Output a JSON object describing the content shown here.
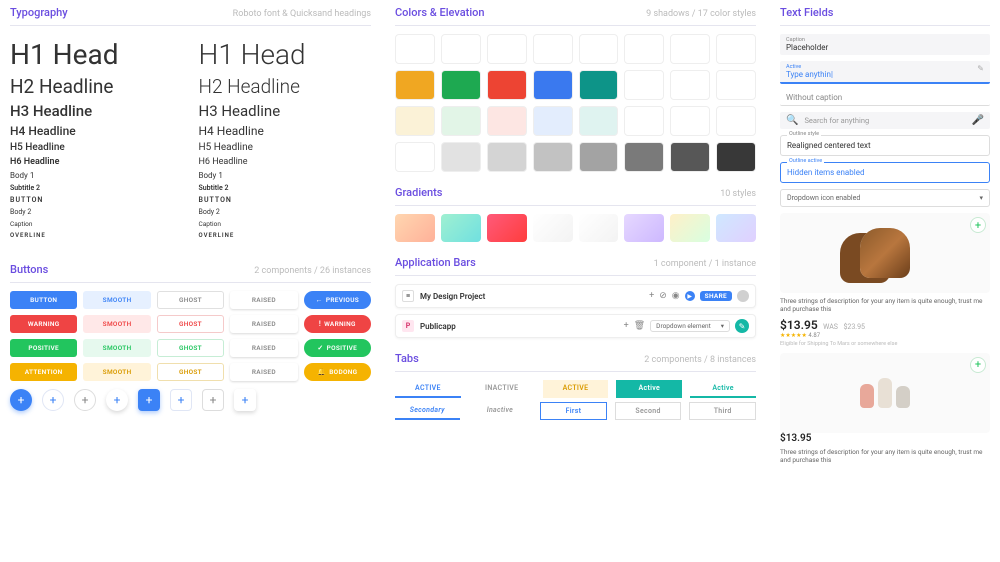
{
  "typography": {
    "title": "Typography",
    "subtitle": "Roboto font & Quicksand headings",
    "samples": {
      "h1": "H1 Head",
      "h2": "H2 Headline",
      "h3": "H3 Headline",
      "h4": "H4 Headline",
      "h5": "H5 Headline",
      "h6": "H6 Headline",
      "body1": "Body 1",
      "subtitle2": "Subtitle 2",
      "button": "BUTTON",
      "body2": "Body 2",
      "caption": "Caption",
      "overline": "OVERLINE"
    }
  },
  "buttons": {
    "title": "Buttons",
    "subtitle": "2 components  / 26 instances",
    "labels": {
      "button": "BUTTON",
      "smooth": "SMOOTH",
      "ghost": "GHOST",
      "raised": "RAISED",
      "previous": "PREVIOUS",
      "warning": "WARNING",
      "positive": "POSITIVE",
      "attention": "ATTENTION",
      "bodong": "BODONG"
    }
  },
  "colors": {
    "title": "Colors & Elevation",
    "subtitle": "9 shadows / 17 color styles",
    "row1": [
      "#ffffff",
      "#ffffff",
      "#ffffff",
      "#ffffff",
      "#ffffff",
      "#ffffff",
      "#ffffff",
      "#ffffff"
    ],
    "row2": [
      "#f0a722",
      "#1ea951",
      "#ed4433",
      "#3a79ef",
      "#0d9488",
      "#ffffff",
      "#ffffff",
      "#ffffff"
    ],
    "row3": [
      "#fbf2d7",
      "#e2f5e7",
      "#fde6e3",
      "#e3edfd",
      "#dff3f0",
      "#ffffff",
      "#ffffff",
      "#ffffff"
    ],
    "row4": [
      "#ffffff",
      "#e2e2e2",
      "#d4d4d4",
      "#c2c2c2",
      "#a3a3a3",
      "#7a7a7a",
      "#575757",
      "#383838"
    ]
  },
  "gradients": {
    "title": "Gradients",
    "subtitle": "10 styles",
    "items": [
      "linear-gradient(135deg,#ffd6b0,#ffb199)",
      "linear-gradient(135deg,#9ff0d1,#70e0e0)",
      "linear-gradient(135deg,#ff5a7a,#ff3d3d)",
      "linear-gradient(135deg,#ffffff,#f3f3f3)",
      "linear-gradient(135deg,#ffffff,#f3f3f3)",
      "linear-gradient(135deg,#e6d8ff,#cdb8ff)",
      "linear-gradient(135deg,#fff0c8,#d8ffe0)",
      "linear-gradient(135deg,#cfe8ff,#e0d0ff)"
    ]
  },
  "appbars": {
    "title": "Application Bars",
    "subtitle": "1 component  /  1 instance",
    "bar1": {
      "title": "My Design Project",
      "share": "SHARE"
    },
    "bar2": {
      "badge": "P",
      "title": "Publicapp",
      "dropdown": "Dropdown element"
    }
  },
  "tabs": {
    "title": "Tabs",
    "subtitle": "2 components  /  8 instances",
    "row1": {
      "active": "ACTIVE",
      "inactive": "INACTIVE",
      "active2": "ACTIVE",
      "active3": "Active",
      "active4": "Active"
    },
    "row2": {
      "secondary": "Secondary",
      "inactive": "Inactive",
      "first": "First",
      "second": "Second",
      "third": "Third"
    }
  },
  "textfields": {
    "title": "Text Fields",
    "caption_label": "Caption",
    "caption_value": "Placeholder",
    "active_label": "Active",
    "active_value": "Type anythin|",
    "without": "Without caption",
    "search": "Search for anything",
    "outline_label": "Outline style",
    "outline_value": "Realigned centered text",
    "outline_active_label": "Outline active",
    "outline_active_value": "Hidden items enabled",
    "dropdown": "Dropdown icon enabled"
  },
  "product1": {
    "desc": "Three strings of description for your any item is quite enough, trust me and purchase this",
    "price": "$13.95",
    "was_label": "WAS",
    "was": "$23.95",
    "rating": "4.87",
    "ship": "Eligible for Shipping To Mars or somewhere else"
  },
  "product2": {
    "price": "$13.95",
    "desc": "Three strings of description for your any item is quite enough, trust me and purchase this"
  }
}
